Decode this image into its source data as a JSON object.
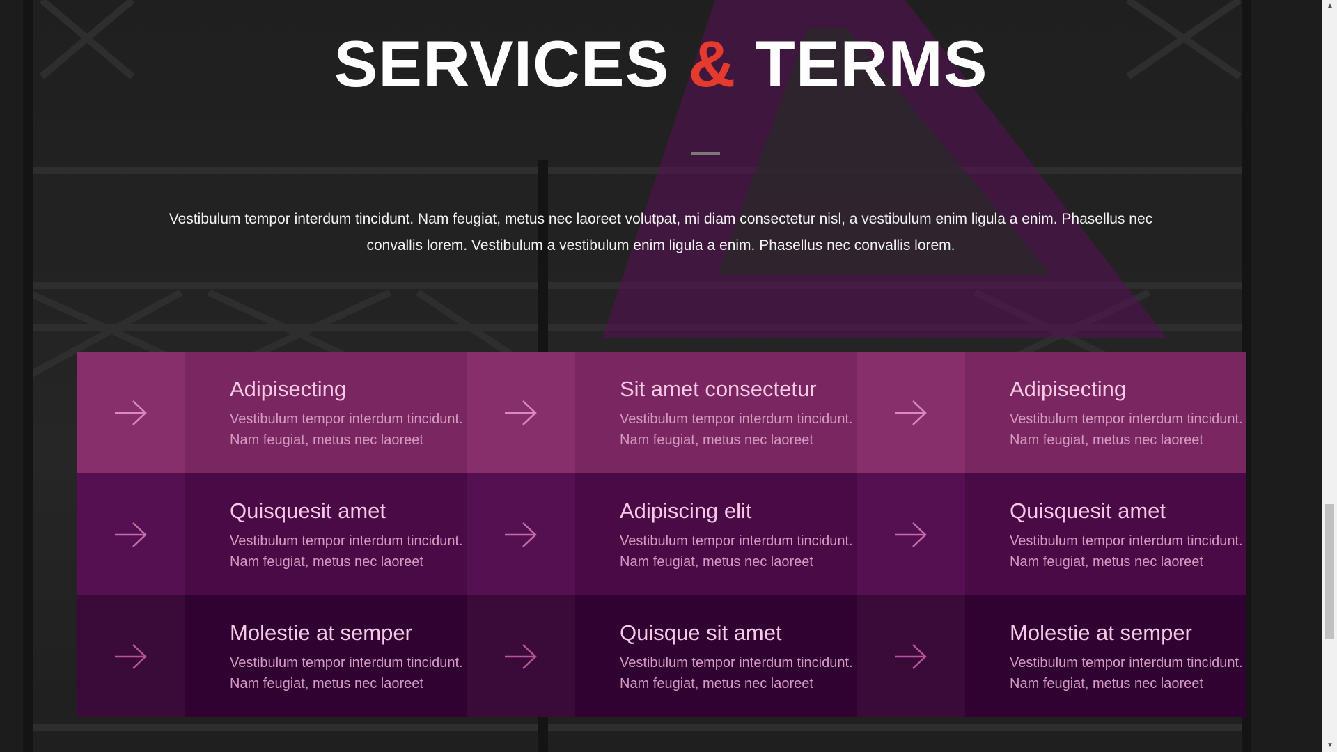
{
  "section": {
    "title_part1": "SERVICES",
    "title_amp": "&",
    "title_part2": "TERMS",
    "intro_line1": "Vestibulum tempor interdum tincidunt. Nam feugiat, metus nec laoreet volutpat, mi diam consectetur nisl, a vestibulum enim ligula a enim. Phasellus nec",
    "intro_line2": "convallis lorem. Vestibulum a vestibulum enim ligula a enim. Phasellus nec convallis lorem."
  },
  "colors": {
    "accent": "#e53a2e",
    "row1": "#7a2660",
    "row2": "#4a0a46",
    "row3": "#300231",
    "triangle": "#5a0f55"
  },
  "services": [
    {
      "title": "Adipisecting",
      "desc1": "Vestibulum tempor interdum tincidunt.",
      "desc2": "Nam feugiat, metus nec laoreet",
      "icon": "arrow-right-icon"
    },
    {
      "title": "Sit amet consectetur",
      "desc1": "Vestibulum tempor interdum tincidunt.",
      "desc2": "Nam feugiat, metus nec laoreet",
      "icon": "arrow-right-icon"
    },
    {
      "title": "Adipisecting",
      "desc1": "Vestibulum tempor interdum tincidunt.",
      "desc2": "Nam feugiat, metus nec laoreet",
      "icon": "arrow-right-icon"
    },
    {
      "title": "Quisquesit amet",
      "desc1": "Vestibulum tempor interdum tincidunt.",
      "desc2": "Nam feugiat, metus nec laoreet",
      "icon": "arrow-right-icon"
    },
    {
      "title": "Adipiscing elit",
      "desc1": "Vestibulum tempor interdum tincidunt.",
      "desc2": "Nam feugiat, metus nec laoreet",
      "icon": "arrow-right-icon"
    },
    {
      "title": "Quisquesit amet",
      "desc1": "Vestibulum tempor interdum tincidunt.",
      "desc2": "Nam feugiat, metus nec laoreet",
      "icon": "arrow-right-icon"
    },
    {
      "title": "Molestie at semper",
      "desc1": "Vestibulum tempor interdum tincidunt.",
      "desc2": "Nam feugiat, metus nec laoreet",
      "icon": "arrow-right-icon"
    },
    {
      "title": "Quisque sit amet",
      "desc1": "Vestibulum tempor interdum tincidunt.",
      "desc2": "Nam feugiat, metus nec laoreet",
      "icon": "arrow-right-icon"
    },
    {
      "title": "Molestie at semper",
      "desc1": "Vestibulum tempor interdum tincidunt.",
      "desc2": "Nam feugiat, metus nec laoreet",
      "icon": "arrow-right-icon"
    }
  ]
}
